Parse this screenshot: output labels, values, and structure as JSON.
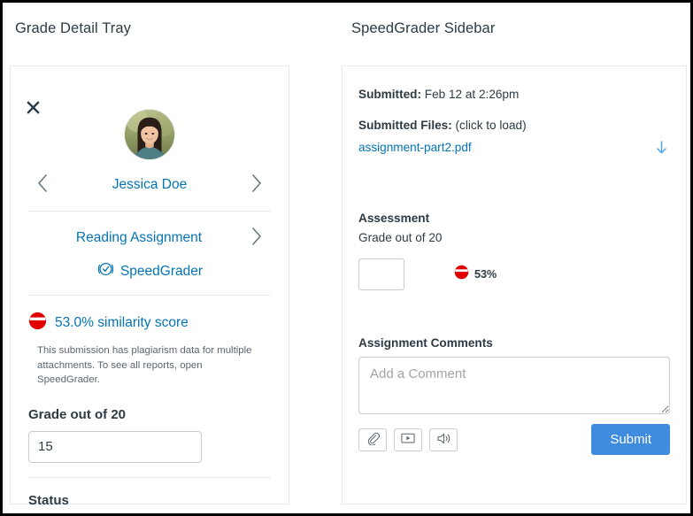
{
  "page": {
    "left_section_title": "Grade Detail Tray",
    "right_section_title": "SpeedGrader Sidebar"
  },
  "colors": {
    "link": "#0374B5",
    "text": "#2D3B45",
    "muted": "#5B6670",
    "border": "#C7CDD1",
    "card_border": "#E8EAEC",
    "similarity_red": "#E00000",
    "submit_blue": "#3F8BE0"
  },
  "tray": {
    "close_icon": "close-icon",
    "avatar_alt": "avatar",
    "prev_icon": "chevron-left-icon",
    "next_icon": "chevron-right-icon",
    "student_name": "Jessica Doe",
    "assignment_name": "Reading Assignment",
    "assignment_next_icon": "chevron-right-icon",
    "speedgrader_icon": "speedgrader-icon",
    "speedgrader_label": "SpeedGrader",
    "similarity_icon": "similarity-score-icon",
    "similarity_label": "53.0% similarity score",
    "similarity_percent": 53.0,
    "plagiarism_note": "This submission has plagiarism data for multiple attachments. To see all reports, open SpeedGrader.",
    "grade_label": "Grade out of 20",
    "grade_value": "15",
    "grade_points_possible": 20,
    "status_label": "Status"
  },
  "sidebar": {
    "submitted_label": "Submitted:",
    "submitted_value": "Feb 12 at 2:26pm",
    "submitted_files_label": "Submitted Files:",
    "submitted_files_hint": "(click to load)",
    "file_name": "assignment-part2.pdf",
    "download_icon": "download-arrow-icon",
    "assessment_label": "Assessment",
    "grade_out_of_label": "Grade out of 20",
    "grade_value": "",
    "grade_placeholder": "",
    "similarity_icon": "similarity-score-icon",
    "similarity_percent_label": "53%",
    "comments_label": "Assignment Comments",
    "comment_value": "",
    "comment_placeholder": "Add a Comment",
    "tools": [
      {
        "name": "attach-file-button",
        "icon": "paperclip-icon"
      },
      {
        "name": "record-media-button",
        "icon": "video-icon"
      },
      {
        "name": "record-audio-button",
        "icon": "speaker-icon"
      }
    ],
    "submit_label": "Submit"
  }
}
